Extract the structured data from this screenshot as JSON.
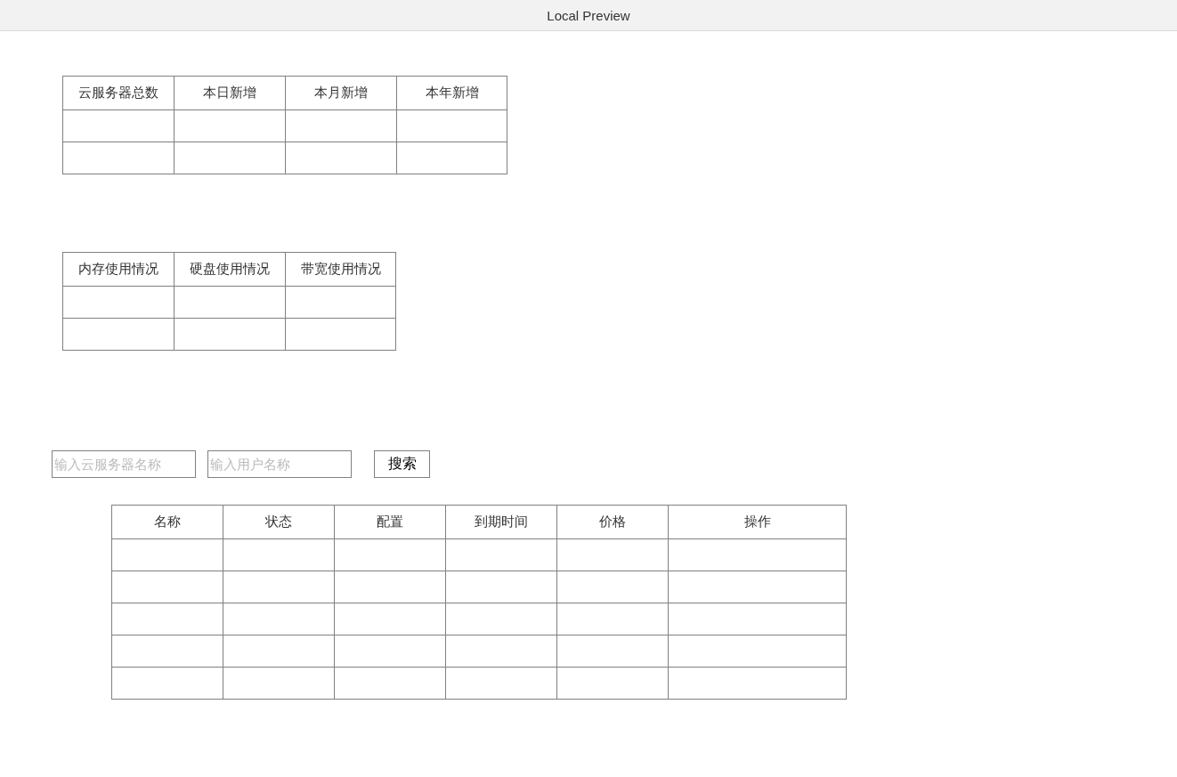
{
  "window": {
    "title": "Local Preview"
  },
  "summary_table": {
    "columns": [
      "云服务器总数",
      "本日新增",
      "本月新增",
      "本年新增"
    ]
  },
  "usage_table": {
    "columns": [
      "内存使用情况",
      "硬盘使用情况",
      "带宽使用情况"
    ]
  },
  "search": {
    "fields": [
      {
        "placeholder": "输入云服务器名称"
      },
      {
        "placeholder": "输入用户名称"
      }
    ],
    "button": "搜索"
  },
  "server_table": {
    "columns": [
      "名称",
      "状态",
      "配置",
      "到期时间",
      "价格",
      "操作"
    ]
  }
}
